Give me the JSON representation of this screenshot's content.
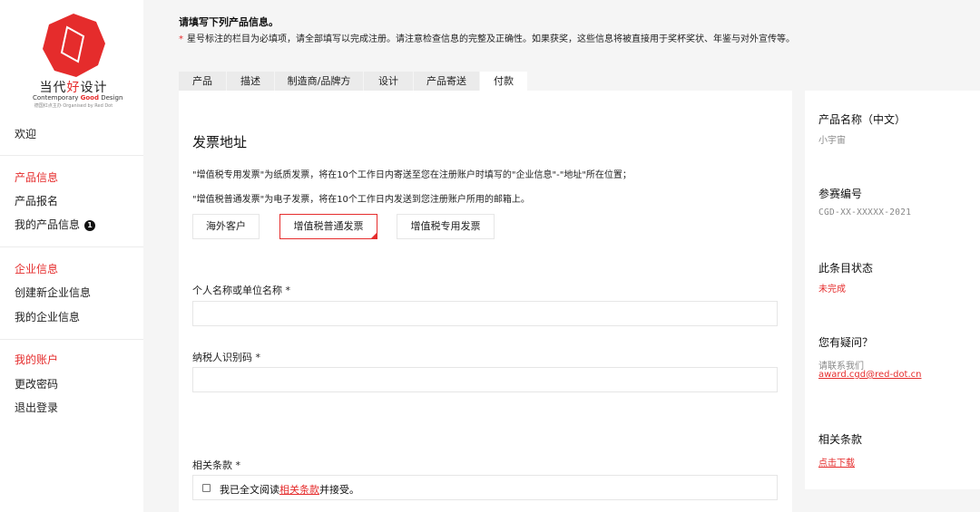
{
  "brand": {
    "title_prefix": "当代",
    "title_red": "好",
    "title_suffix": "设计",
    "sub_prefix": "Contemporary ",
    "sub_red": "Good",
    "sub_suffix": " Design",
    "organiser": "德国红点主办 Organised by Red Dot",
    "accent_color": "#e52c2c"
  },
  "sidebar": {
    "welcome": "欢迎",
    "product_heading": "产品信息",
    "product_signup": "产品报名",
    "my_products": "我的产品信息",
    "my_products_badge": "1",
    "company_heading": "企业信息",
    "create_company": "创建新企业信息",
    "my_company": "我的企业信息",
    "account_heading": "我的账户",
    "change_password": "更改密码",
    "logout": "退出登录"
  },
  "header": {
    "title": "请填写下列产品信息。",
    "required_star": "*",
    "note": "星号标注的栏目为必填项，请全部填写以完成注册。请注意检查信息的完整及正确性。如果获奖，这些信息将被直接用于奖杯奖状、年鉴与对外宣传等。"
  },
  "tabs": [
    "产品",
    "描述",
    "制造商/品牌方",
    "设计",
    "产品寄送",
    "付款"
  ],
  "active_tab": "付款",
  "invoice": {
    "title": "发票地址",
    "desc1": "\"增值税专用发票\"为纸质发票，将在10个工作日内寄送至您在注册账户时填写的\"企业信息\"-\"地址\"所在位置；",
    "desc2": "\"增值税普通发票\"为电子发票，将在10个工作日内发送到您注册账户所用的邮箱上。",
    "options": [
      "海外客户",
      "增值税普通发票",
      "增值税专用发票"
    ],
    "selected": "增值税普通发票",
    "name_label": "个人名称或单位名称 *",
    "name_value": "",
    "tax_label": "纳税人识别码 *",
    "tax_value": "",
    "terms_label": "相关条款 *",
    "terms_prefix": "我已全文阅读",
    "terms_link": "相关条款",
    "terms_suffix": "并接受。",
    "terms_checked": false
  },
  "info_panel": {
    "product_name_label": "产品名称（中文）",
    "product_name_value": "小宇宙",
    "entry_no_label": "参赛编号",
    "entry_no_value": "CGD-XX-XXXXX-2021",
    "status_label": "此条目状态",
    "status_value": "未完成",
    "question_label": "您有疑问？",
    "contact_text": "请联系我们",
    "contact_email": "award.cgd@red-dot.cn",
    "terms_label": "相关条款",
    "download_link": "点击下载"
  }
}
